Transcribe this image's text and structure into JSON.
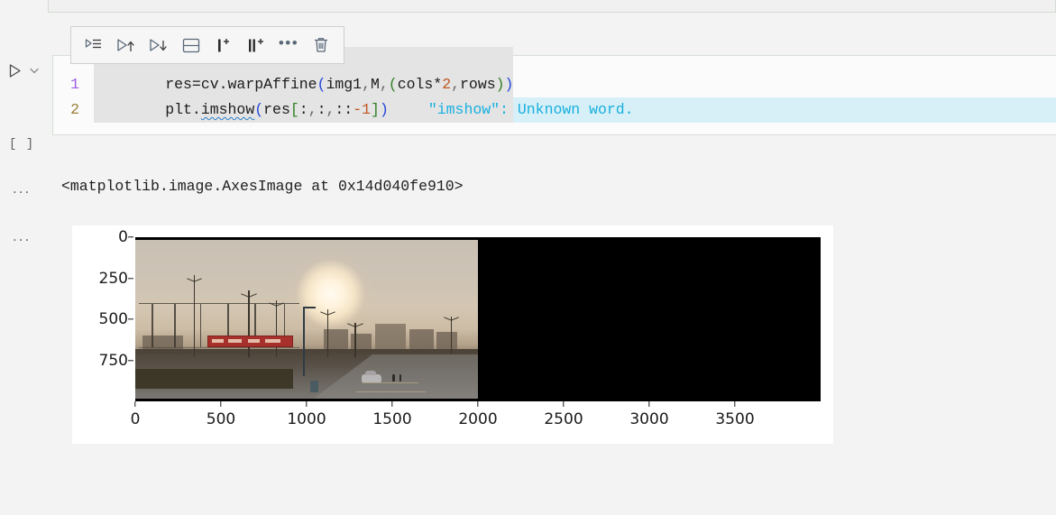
{
  "notebook": {
    "prev_cell_name": "previous-cell",
    "run_button_label": "run-cell",
    "execution_count": "[ ]",
    "output_prompt_1": "...",
    "output_prompt_2": "..."
  },
  "toolbar": {
    "buttons": [
      {
        "name": "execute-cell-and-advance-icon",
        "title": "Execute Cell and Advance"
      },
      {
        "name": "execute-above-cells-icon",
        "title": "Execute Above Cells"
      },
      {
        "name": "execute-cell-and-below-icon",
        "title": "Execute Cell and Below"
      },
      {
        "name": "split-cell-icon",
        "title": "Split Cell"
      },
      {
        "name": "insert-cell-above-icon",
        "title": "Insert Cell Above"
      },
      {
        "name": "insert-cell-below-icon",
        "title": "Insert Cell Below"
      },
      {
        "name": "more-actions-icon",
        "title": "More Actions"
      },
      {
        "name": "delete-cell-icon",
        "title": "Delete Cell"
      }
    ],
    "more_glyph": "•••"
  },
  "code": {
    "lines": [
      {
        "number": "1",
        "tokens": [
          {
            "text": "res=cv.warpAffine",
            "cls": "t-ident"
          },
          {
            "text": "(",
            "cls": "t-blue"
          },
          {
            "text": "img1",
            "cls": "t-ident"
          },
          {
            "text": ",",
            "cls": "t-comma"
          },
          {
            "text": "M",
            "cls": "t-ident"
          },
          {
            "text": ",",
            "cls": "t-comma"
          },
          {
            "text": "(",
            "cls": "t-green"
          },
          {
            "text": "cols",
            "cls": "t-ident"
          },
          {
            "text": "*",
            "cls": "t-op"
          },
          {
            "text": "2",
            "cls": "t-num"
          },
          {
            "text": ",",
            "cls": "t-comma"
          },
          {
            "text": "rows",
            "cls": "t-ident"
          },
          {
            "text": ")",
            "cls": "t-green"
          },
          {
            "text": ")",
            "cls": "t-blue"
          }
        ]
      },
      {
        "number": "2",
        "tokens": [
          {
            "text": "plt.",
            "cls": "t-ident"
          },
          {
            "text": "imshow",
            "cls": "t-ident squiggle"
          },
          {
            "text": "(",
            "cls": "t-blue"
          },
          {
            "text": "res",
            "cls": "t-ident"
          },
          {
            "text": "[",
            "cls": "t-green"
          },
          {
            "text": ":",
            "cls": "t-plain"
          },
          {
            "text": ",",
            "cls": "t-comma"
          },
          {
            "text": ":",
            "cls": "t-plain"
          },
          {
            "text": ",",
            "cls": "t-comma"
          },
          {
            "text": "::",
            "cls": "t-plain"
          },
          {
            "text": "-1",
            "cls": "t-num"
          },
          {
            "text": "]",
            "cls": "t-green"
          },
          {
            "text": ")",
            "cls": "t-blue"
          }
        ]
      }
    ],
    "spell_warning": "\"imshow\": Unknown word."
  },
  "output": {
    "repr_text": "<matplotlib.image.AxesImage at 0x14d040fe910>"
  },
  "colors": {
    "spell_warning_text": "#18b0e0",
    "spell_warning_bg": "#d7f0f7",
    "selection_bg": "#e4e4e4",
    "bracket_depth1": "#2346d8",
    "bracket_depth2": "#2f7f23",
    "number_literal": "#c05621",
    "line_number_1": "#9b5ee0",
    "line_number_2": "#9c8038",
    "page_bg": "#f3f3f3",
    "cell_bg": "#fbfbfb"
  },
  "chart_data": {
    "type": "heatmap",
    "title": "",
    "xlabel": "",
    "ylabel": "",
    "xlim": [
      0,
      4000
    ],
    "ylim": [
      1000,
      0
    ],
    "xticks": [
      0,
      500,
      1000,
      1500,
      2000,
      2500,
      3000,
      3500
    ],
    "xticklabels": [
      "0",
      "500",
      "1000",
      "1500",
      "2000",
      "2500",
      "3000",
      "3500"
    ],
    "yticks": [
      0,
      250,
      500,
      750
    ],
    "yticklabels": [
      "0",
      "250",
      "500",
      "750"
    ],
    "grid": false,
    "legend": null,
    "description": "matplotlib imshow of a warpAffine result: the original RGB street-at-sunset photo occupies x 0-2000, the translated remainder x 2000-4000 is filled with black.",
    "regions": [
      {
        "name": "photo",
        "x_range": [
          0,
          2000
        ],
        "y_range": [
          0,
          1000
        ],
        "content": "sunset street scene"
      },
      {
        "name": "black-fill",
        "x_range": [
          2000,
          4000
        ],
        "y_range": [
          0,
          1000
        ],
        "content": "black"
      }
    ]
  }
}
